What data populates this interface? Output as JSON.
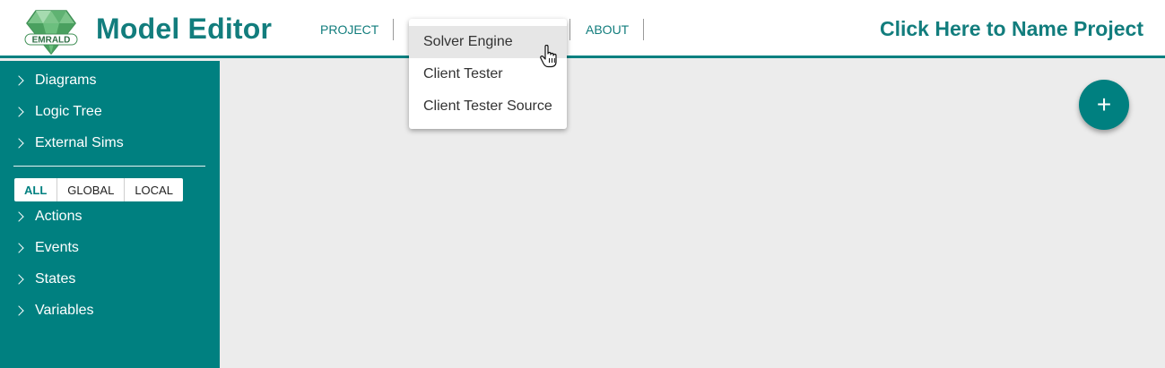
{
  "header": {
    "logo_text": "EMRALD",
    "app_title": "Model Editor",
    "nav": [
      {
        "label": "PROJECT"
      },
      {
        "label": "ABOUT"
      }
    ],
    "project_name": "Click Here to Name Project"
  },
  "dropdown": {
    "items": [
      {
        "label": "Solver Engine",
        "hovered": true
      },
      {
        "label": "Client Tester"
      },
      {
        "label": "Client Tester Source"
      }
    ]
  },
  "sidebar": {
    "top_items": [
      {
        "label": "Diagrams"
      },
      {
        "label": "Logic Tree"
      },
      {
        "label": "External Sims"
      }
    ],
    "scope_tabs": [
      {
        "label": "ALL",
        "active": true
      },
      {
        "label": "GLOBAL"
      },
      {
        "label": "LOCAL"
      }
    ],
    "bottom_items": [
      {
        "label": "Actions"
      },
      {
        "label": "Events"
      },
      {
        "label": "States"
      },
      {
        "label": "Variables"
      }
    ]
  },
  "fab": {
    "label": "+"
  },
  "colors": {
    "accent": "#008080",
    "title": "#127d7d",
    "workspace": "#ececec"
  }
}
